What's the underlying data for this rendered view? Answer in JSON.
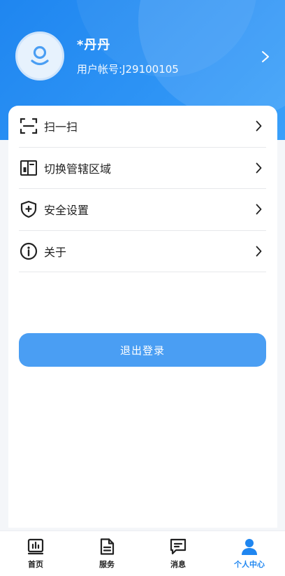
{
  "header": {
    "user_name": "*丹丹",
    "account_label": "用户帐号:J29100105"
  },
  "menu": {
    "items": [
      {
        "label": "扫一扫",
        "icon": "scan-icon"
      },
      {
        "label": "切换管辖区域",
        "icon": "building-switch-icon"
      },
      {
        "label": "安全设置",
        "icon": "shield-plus-icon"
      },
      {
        "label": "关于",
        "icon": "info-icon"
      }
    ]
  },
  "logout": {
    "label": "退出登录"
  },
  "tabbar": {
    "tabs": [
      {
        "label": "首页",
        "icon": "chart-icon",
        "active": false
      },
      {
        "label": "服务",
        "icon": "document-icon",
        "active": false
      },
      {
        "label": "消息",
        "icon": "message-icon",
        "active": false
      },
      {
        "label": "个人中心",
        "icon": "person-icon",
        "active": true
      }
    ]
  },
  "colors": {
    "header_blue": "#1f86f0",
    "button_blue": "#4a9ef3",
    "active_tab": "#1f86f0",
    "text_primary": "#222222"
  }
}
